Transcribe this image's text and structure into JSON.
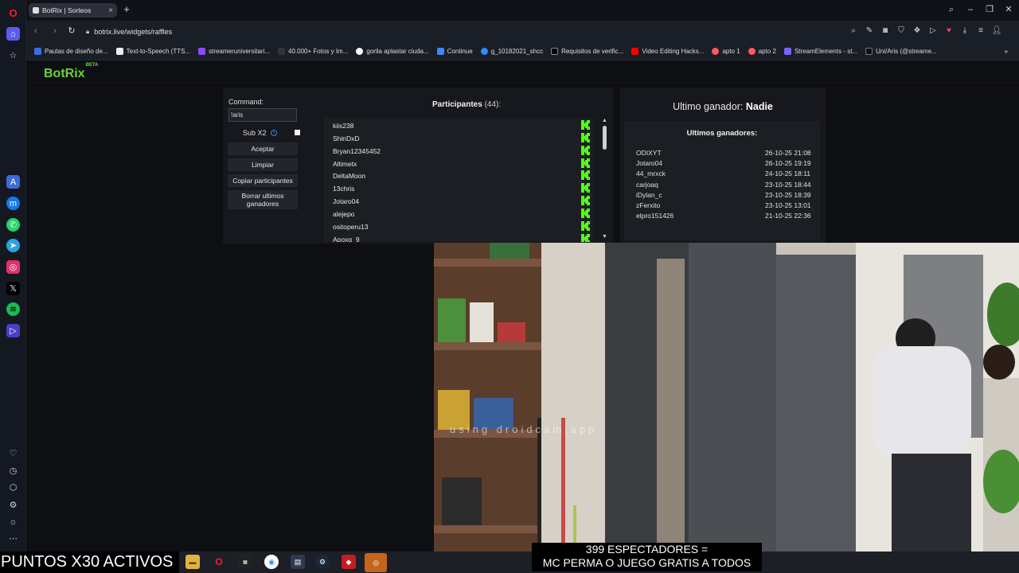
{
  "browser": {
    "tab_title": "BotRix | Sorteos",
    "url": "botrix.live/widgets/raffles",
    "bookmarks": [
      {
        "label": "Pautas de diseño de...",
        "color": "#3b6edc"
      },
      {
        "label": "Text-to-Speech (TTS...",
        "color": "#eeeeee"
      },
      {
        "label": "streameruniversitari...",
        "color": "#9146ff"
      },
      {
        "label": "40.000+ Fotos y Im...",
        "color": "#333333"
      },
      {
        "label": "gorila aplastar ciuda...",
        "color": "#ffffff"
      },
      {
        "label": "Continue",
        "color": "#4285f4"
      },
      {
        "label": "g_10182021_shcc",
        "color": "#2d8cff"
      },
      {
        "label": "Requisitos de verific...",
        "color": "#000000"
      },
      {
        "label": "Video Editing Hacks...",
        "color": "#ff0000"
      },
      {
        "label": "apto 1",
        "color": "#ff5a5f"
      },
      {
        "label": "apto 2",
        "color": "#ff5a5f"
      },
      {
        "label": "StreamElements - st...",
        "color": "#7b61ff"
      },
      {
        "label": "Uni/Aris (@streame...",
        "color": "#111111"
      }
    ]
  },
  "botrix": {
    "logo": "BotRix",
    "logo_badge": "BETA",
    "command_label": "Command:",
    "command_value": "!aris",
    "sub_label": "Sub X2",
    "buttons": {
      "accept": "Aceptar",
      "clear": "Limpiar",
      "copy": "Copiar participantes",
      "delete_winners": "Borrar ultimos ganadores"
    },
    "participants_title": "Participantes",
    "participants_count": "(44):",
    "participants": [
      "kiis238",
      "ShinDxD",
      "Bryan12345452",
      "Altimetx",
      "DeltaMoon",
      "13chris",
      "Jotaro04",
      "alejepo",
      "ositoperu13",
      "Apoxq_9"
    ],
    "last_winner_label": "Ultimo ganador:",
    "last_winner_value": "Nadie",
    "winners_title": "Ultimos ganadores:",
    "winners": [
      {
        "name": "ODIXYT",
        "date": "26-10-25 21:08"
      },
      {
        "name": "Jotaro04",
        "date": "26-10-25 19:19"
      },
      {
        "name": "44_mrxck",
        "date": "24-10-25 18:11"
      },
      {
        "name": "carjoaq",
        "date": "23-10-25 18:44"
      },
      {
        "name": "iDylan_c",
        "date": "23-10-25 18:39"
      },
      {
        "name": "zFerxito",
        "date": "23-10-25 13:01"
      },
      {
        "name": "elpro151426",
        "date": "21-10-25 22:36"
      }
    ]
  },
  "overlay": {
    "puntos": "PUNTOS X30 ACTIVOS",
    "viewers_line1": "399 ESPECTADORES =",
    "viewers_line2": "MC PERMA O JUEGO GRATIS A TODOS",
    "watermark": "using droidcam.app"
  },
  "colors": {
    "accent_green": "#6ad23b",
    "panel": "#16181d"
  }
}
